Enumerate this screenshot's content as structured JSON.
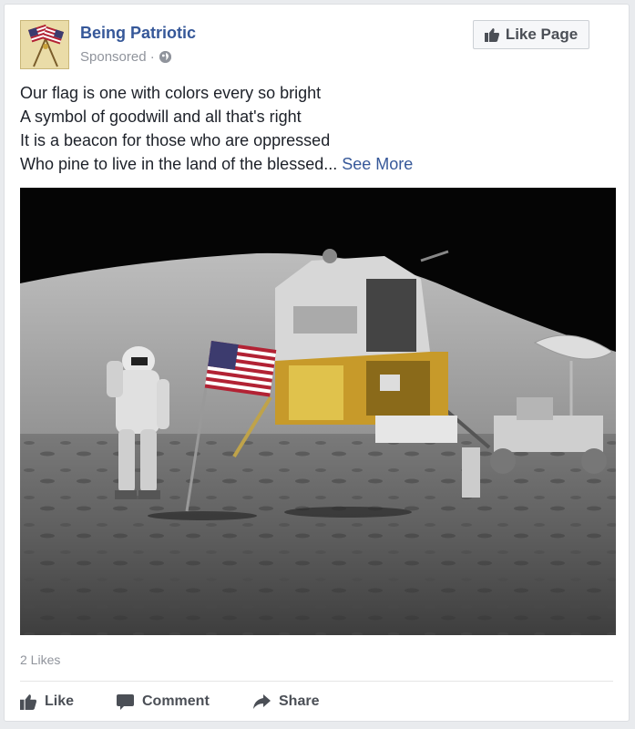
{
  "post": {
    "page_name": "Being Patriotic",
    "sponsored": "Sponsored ·",
    "like_page_label": "Like Page",
    "text_lines": [
      "Our flag is one with colors every so bright",
      "A symbol of goodwill and all that's right",
      "It is a beacon for those who are oppressed",
      "Who pine to live in the land of the blessed..."
    ],
    "see_more": "See More",
    "likes_count": "2 Likes"
  },
  "actions": {
    "like": "Like",
    "comment": "Comment",
    "share": "Share"
  },
  "icons": {
    "globe": "globe-icon",
    "thumbs_up": "thumbs-up-icon",
    "comment": "comment-icon",
    "share": "share-arrow-icon"
  },
  "colors": {
    "link": "#365899",
    "meta": "#90949c",
    "text": "#1d2129",
    "action": "#4b4f56"
  }
}
